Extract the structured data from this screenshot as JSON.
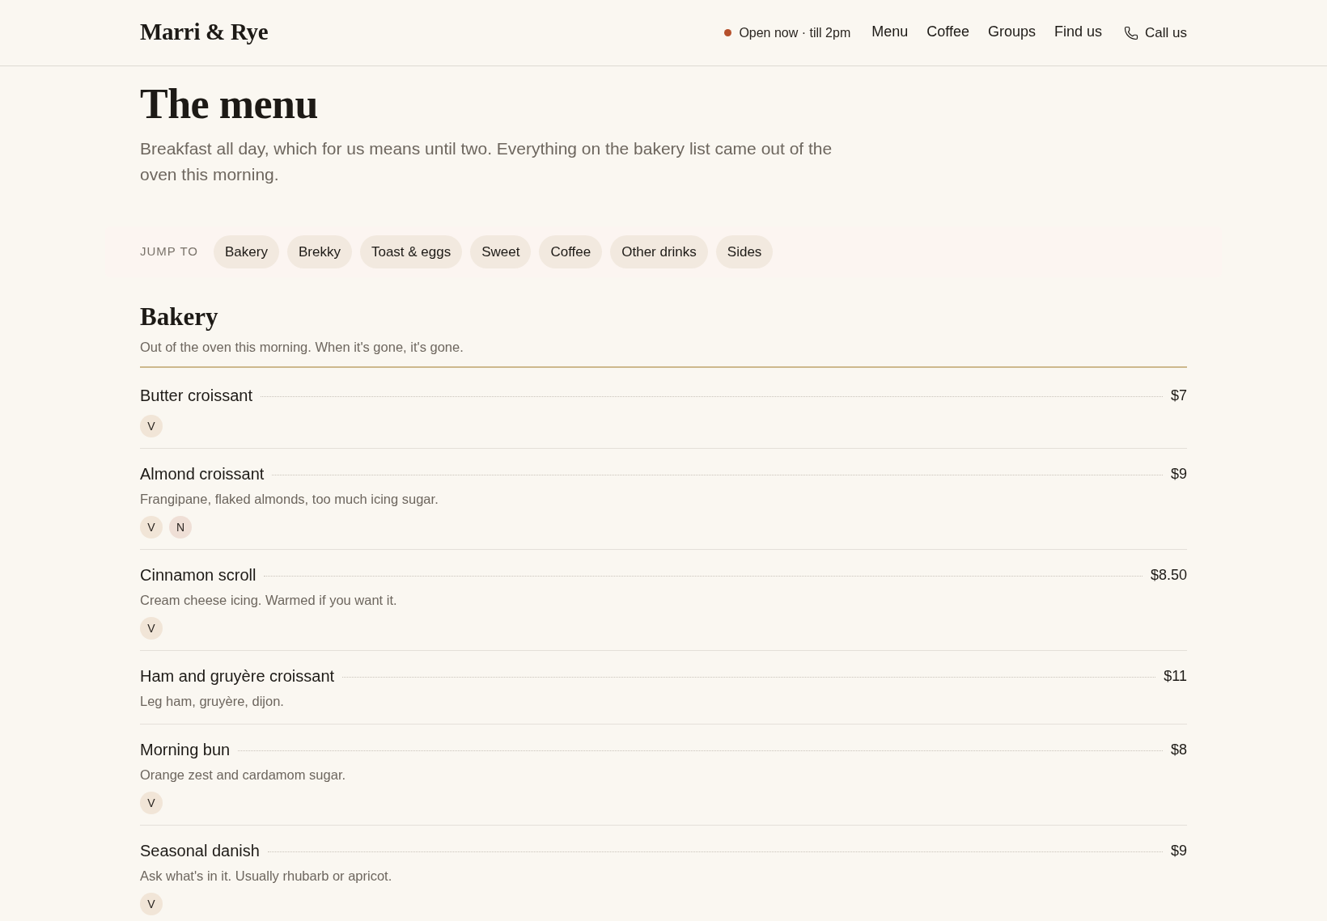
{
  "header": {
    "logo": "Marri & Rye",
    "status": "Open now · till 2pm",
    "nav": [
      "Menu",
      "Coffee",
      "Groups",
      "Find us"
    ],
    "call": "Call us"
  },
  "page": {
    "title": "The menu",
    "intro": "Breakfast all day, which for us means until two. Everything on the bakery list came out of the oven this morning."
  },
  "jump_bar": {
    "label": "JUMP TO",
    "links": [
      "Bakery",
      "Brekky",
      "Toast & eggs",
      "Sweet",
      "Coffee",
      "Other drinks",
      "Sides"
    ]
  },
  "sections": [
    {
      "heading": "Bakery",
      "description": "Out of the oven this morning. When it's gone, it's gone.",
      "items": [
        {
          "name": "Butter croissant",
          "price": "$7",
          "tags": [
            {
              "label": "V",
              "color": "#f1e5d7"
            }
          ]
        },
        {
          "name": "Almond croissant",
          "price": "$9",
          "description": "Frangipane, flaked almonds, too much icing sugar.",
          "tags": [
            {
              "label": "V",
              "color": "#f1e5d7"
            },
            {
              "label": "N",
              "color": "#efdfd6"
            }
          ]
        },
        {
          "name": "Cinnamon scroll",
          "price": "$8.50",
          "description": "Cream cheese icing. Warmed if you want it.",
          "tags": [
            {
              "label": "V",
              "color": "#f1e5d7"
            }
          ]
        },
        {
          "name": "Ham and gruyère croissant",
          "price": "$11",
          "description": "Leg ham, gruyère, dijon."
        },
        {
          "name": "Morning bun",
          "price": "$8",
          "description": "Orange zest and cardamom sugar.",
          "tags": [
            {
              "label": "V",
              "color": "#f1e5d7"
            }
          ]
        },
        {
          "name": "Seasonal danish",
          "price": "$9",
          "description": "Ask what's in it. Usually rhubarb or apricot.",
          "tags": [
            {
              "label": "V",
              "color": "#f1e5d7"
            }
          ]
        }
      ]
    }
  ]
}
